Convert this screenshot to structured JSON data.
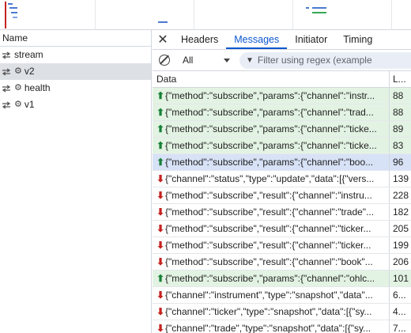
{
  "colors": {
    "sent_bg": "#e3f3e3",
    "selected_bg": "#d8e2f6",
    "sent_arrow": "#188038",
    "received_arrow": "#c5221f",
    "accent": "#0b57d0"
  },
  "requests": {
    "header": "Name",
    "items": [
      {
        "name": "stream",
        "icon": "websocket-icon",
        "has_gear": false,
        "selected": false
      },
      {
        "name": "v2",
        "icon": "websocket-icon",
        "has_gear": true,
        "selected": true
      },
      {
        "name": "health",
        "icon": "websocket-icon",
        "has_gear": true,
        "selected": false
      },
      {
        "name": "v1",
        "icon": "websocket-icon",
        "has_gear": true,
        "selected": false
      }
    ]
  },
  "tabs": {
    "close": "✕",
    "items": [
      {
        "label": "Headers",
        "active": false
      },
      {
        "label": "Messages",
        "active": true
      },
      {
        "label": "Initiator",
        "active": false
      },
      {
        "label": "Timing",
        "active": false
      }
    ]
  },
  "filter": {
    "type_value": "All",
    "placeholder": "Filter using regex (example"
  },
  "table": {
    "col_data": "Data",
    "col_length": "L...",
    "rows": [
      {
        "dir": "up",
        "data": "{\"method\":\"subscribe\",\"params\":{\"channel\":\"instr...",
        "len": "88",
        "kind": "sent"
      },
      {
        "dir": "up",
        "data": "{\"method\":\"subscribe\",\"params\":{\"channel\":\"trad...",
        "len": "88",
        "kind": "sent"
      },
      {
        "dir": "up",
        "data": "{\"method\":\"subscribe\",\"params\":{\"channel\":\"ticke...",
        "len": "89",
        "kind": "sent"
      },
      {
        "dir": "up",
        "data": "{\"method\":\"subscribe\",\"params\":{\"channel\":\"ticke...",
        "len": "83",
        "kind": "sent"
      },
      {
        "dir": "up",
        "data": "{\"method\":\"subscribe\",\"params\":{\"channel\":\"boo...",
        "len": "96",
        "kind": "selected"
      },
      {
        "dir": "down",
        "data": "{\"channel\":\"status\",\"type\":\"update\",\"data\":[{\"vers...",
        "len": "139",
        "kind": "received"
      },
      {
        "dir": "down",
        "data": "{\"method\":\"subscribe\",\"result\":{\"channel\":\"instru...",
        "len": "228",
        "kind": "received"
      },
      {
        "dir": "down",
        "data": "{\"method\":\"subscribe\",\"result\":{\"channel\":\"trade\"...",
        "len": "182",
        "kind": "received"
      },
      {
        "dir": "down",
        "data": "{\"method\":\"subscribe\",\"result\":{\"channel\":\"ticker...",
        "len": "205",
        "kind": "received"
      },
      {
        "dir": "down",
        "data": "{\"method\":\"subscribe\",\"result\":{\"channel\":\"ticker...",
        "len": "199",
        "kind": "received"
      },
      {
        "dir": "down",
        "data": "{\"method\":\"subscribe\",\"result\":{\"channel\":\"book\"...",
        "len": "206",
        "kind": "received"
      },
      {
        "dir": "up",
        "data": "{\"method\":\"subscribe\",\"params\":{\"channel\":\"ohlc...",
        "len": "101",
        "kind": "sent"
      },
      {
        "dir": "down",
        "data": "{\"channel\":\"instrument\",\"type\":\"snapshot\",\"data\"...",
        "len": "6...",
        "kind": "received"
      },
      {
        "dir": "down",
        "data": "{\"channel\":\"ticker\",\"type\":\"snapshot\",\"data\":[{\"sy...",
        "len": "4...",
        "kind": "received"
      },
      {
        "dir": "down",
        "data": "{\"channel\":\"trade\",\"type\":\"snapshot\",\"data\":[{\"sy...",
        "len": "7...",
        "kind": "received"
      }
    ]
  }
}
